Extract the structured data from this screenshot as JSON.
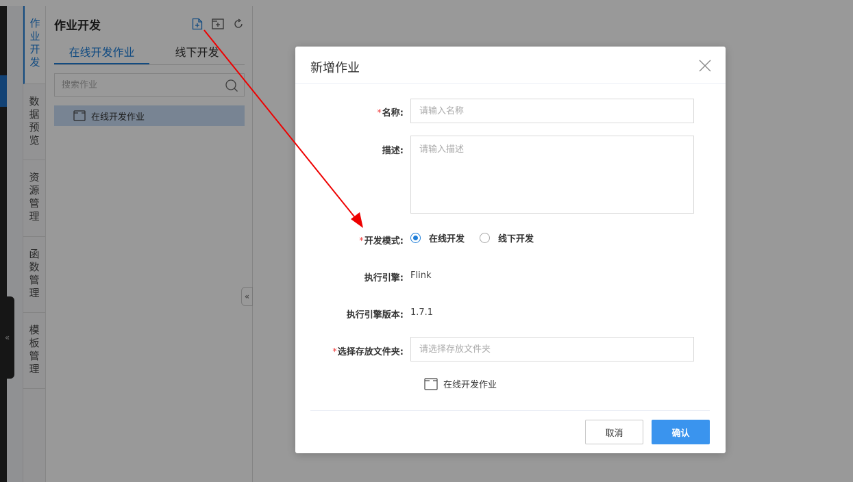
{
  "nav": {
    "items": [
      {
        "label": "作业开发",
        "chars": [
          "作",
          "业",
          "开",
          "发"
        ],
        "active": true
      },
      {
        "label": "数据预览",
        "chars": [
          "数",
          "据",
          "预",
          "览"
        ],
        "active": false
      },
      {
        "label": "资源管理",
        "chars": [
          "资",
          "源",
          "管",
          "理"
        ],
        "active": false
      },
      {
        "label": "函数管理",
        "chars": [
          "函",
          "数",
          "管",
          "理"
        ],
        "active": false
      },
      {
        "label": "模板管理",
        "chars": [
          "模",
          "板",
          "管",
          "理"
        ],
        "active": false
      }
    ],
    "collapse_glyph": "«"
  },
  "panel": {
    "title": "作业开发",
    "icons": [
      "add-file-icon",
      "add-folder-icon",
      "refresh-icon"
    ],
    "tabs": [
      {
        "label": "在线开发作业",
        "active": true
      },
      {
        "label": "线下开发",
        "active": false
      }
    ],
    "search_placeholder": "搜索作业",
    "tree_item": "在线开发作业",
    "collapse_glyph": "«"
  },
  "modal": {
    "title": "新增作业",
    "name_label": "名称:",
    "name_placeholder": "请输入名称",
    "desc_label": "描述:",
    "desc_placeholder": "请输入描述",
    "mode_label": "开发模式:",
    "mode_options": [
      {
        "label": "在线开发",
        "checked": true
      },
      {
        "label": "线下开发",
        "checked": false
      }
    ],
    "engine_label": "执行引擎:",
    "engine_value": "Flink",
    "engine_version_label": "执行引擎版本:",
    "engine_version_value": "1.7.1",
    "folder_label": "选择存放文件夹:",
    "folder_placeholder": "请选择存放文件夹",
    "folder_tree_item": "在线开发作业",
    "required_mark": "*",
    "cancel_label": "取消",
    "confirm_label": "确认"
  },
  "colors": {
    "accent": "#1e7ed8",
    "confirm_button": "#3a94ee",
    "required": "#f03c3c",
    "annotation_arrow": "#ee0000"
  }
}
